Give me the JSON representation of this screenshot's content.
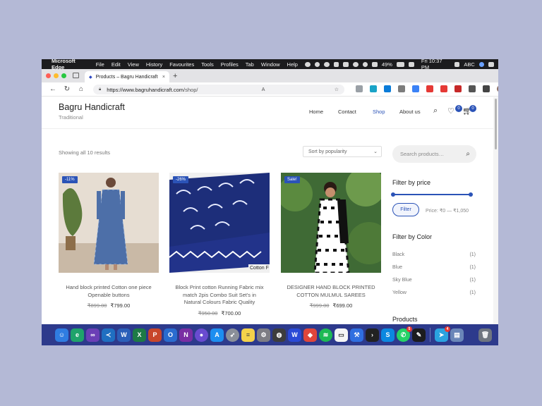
{
  "menubar": {
    "app": "Microsoft Edge",
    "items": [
      "File",
      "Edit",
      "View",
      "History",
      "Favourites",
      "Tools",
      "Profiles",
      "Tab",
      "Window",
      "Help"
    ],
    "battery": "49%",
    "keyboard": "ABC",
    "datetime": "Fri 10:37 PM"
  },
  "browser": {
    "tab_title": "Products – Bagru Handicraft",
    "url_host": "https://www.bagruhandicraft.com",
    "url_path": "/shop/",
    "reader_icon": "A",
    "close": "×",
    "newtab": "+"
  },
  "site": {
    "brand": "Bagru Handicraft",
    "tagline": "Traditional",
    "nav": [
      "Home",
      "Contact",
      "Shop",
      "About us"
    ],
    "wishlist_count": "0",
    "cart_count": "0"
  },
  "shop": {
    "showing": "Showing all 10 results",
    "sort": "Sort by popularity",
    "products": [
      {
        "label": "-11%",
        "name": "Hand block printed Cotton one piece Openable buttons",
        "old_price": "₹899.00",
        "price": "₹799.00"
      },
      {
        "label": "-26%",
        "name": "Block Print cotton Running Fabric mix match 2pis Combo Suit Set's in Natural Colours Fabric Quality",
        "old_price": "₹950.00",
        "price": "₹700.00",
        "image_text": "Cotton F"
      },
      {
        "label": "Sale!",
        "name": "DESIGNER HAND BLOCK PRINTED COTTON MULMUL SAREES",
        "old_price": "₹999.00",
        "price": "₹699.00"
      }
    ]
  },
  "sidebar": {
    "search_placeholder": "Search products…",
    "filter_price_title": "Filter by price",
    "filter_button": "Filter",
    "price_range": "Price: ₹0 — ₹1,050",
    "filter_color_title": "Filter by Color",
    "colors": [
      {
        "name": "Black",
        "count": "(1)"
      },
      {
        "name": "Blue",
        "count": "(1)"
      },
      {
        "name": "Sky Blue",
        "count": "(1)"
      },
      {
        "name": "Yellow",
        "count": "(1)"
      }
    ],
    "products_title": "Products"
  },
  "dock": {
    "whatsapp_badge": "5",
    "telegram_badge": "4"
  },
  "colors": {
    "accent": "#2b53b7",
    "dock": "#2d3a8c",
    "desktop": "#b4b9d6"
  }
}
